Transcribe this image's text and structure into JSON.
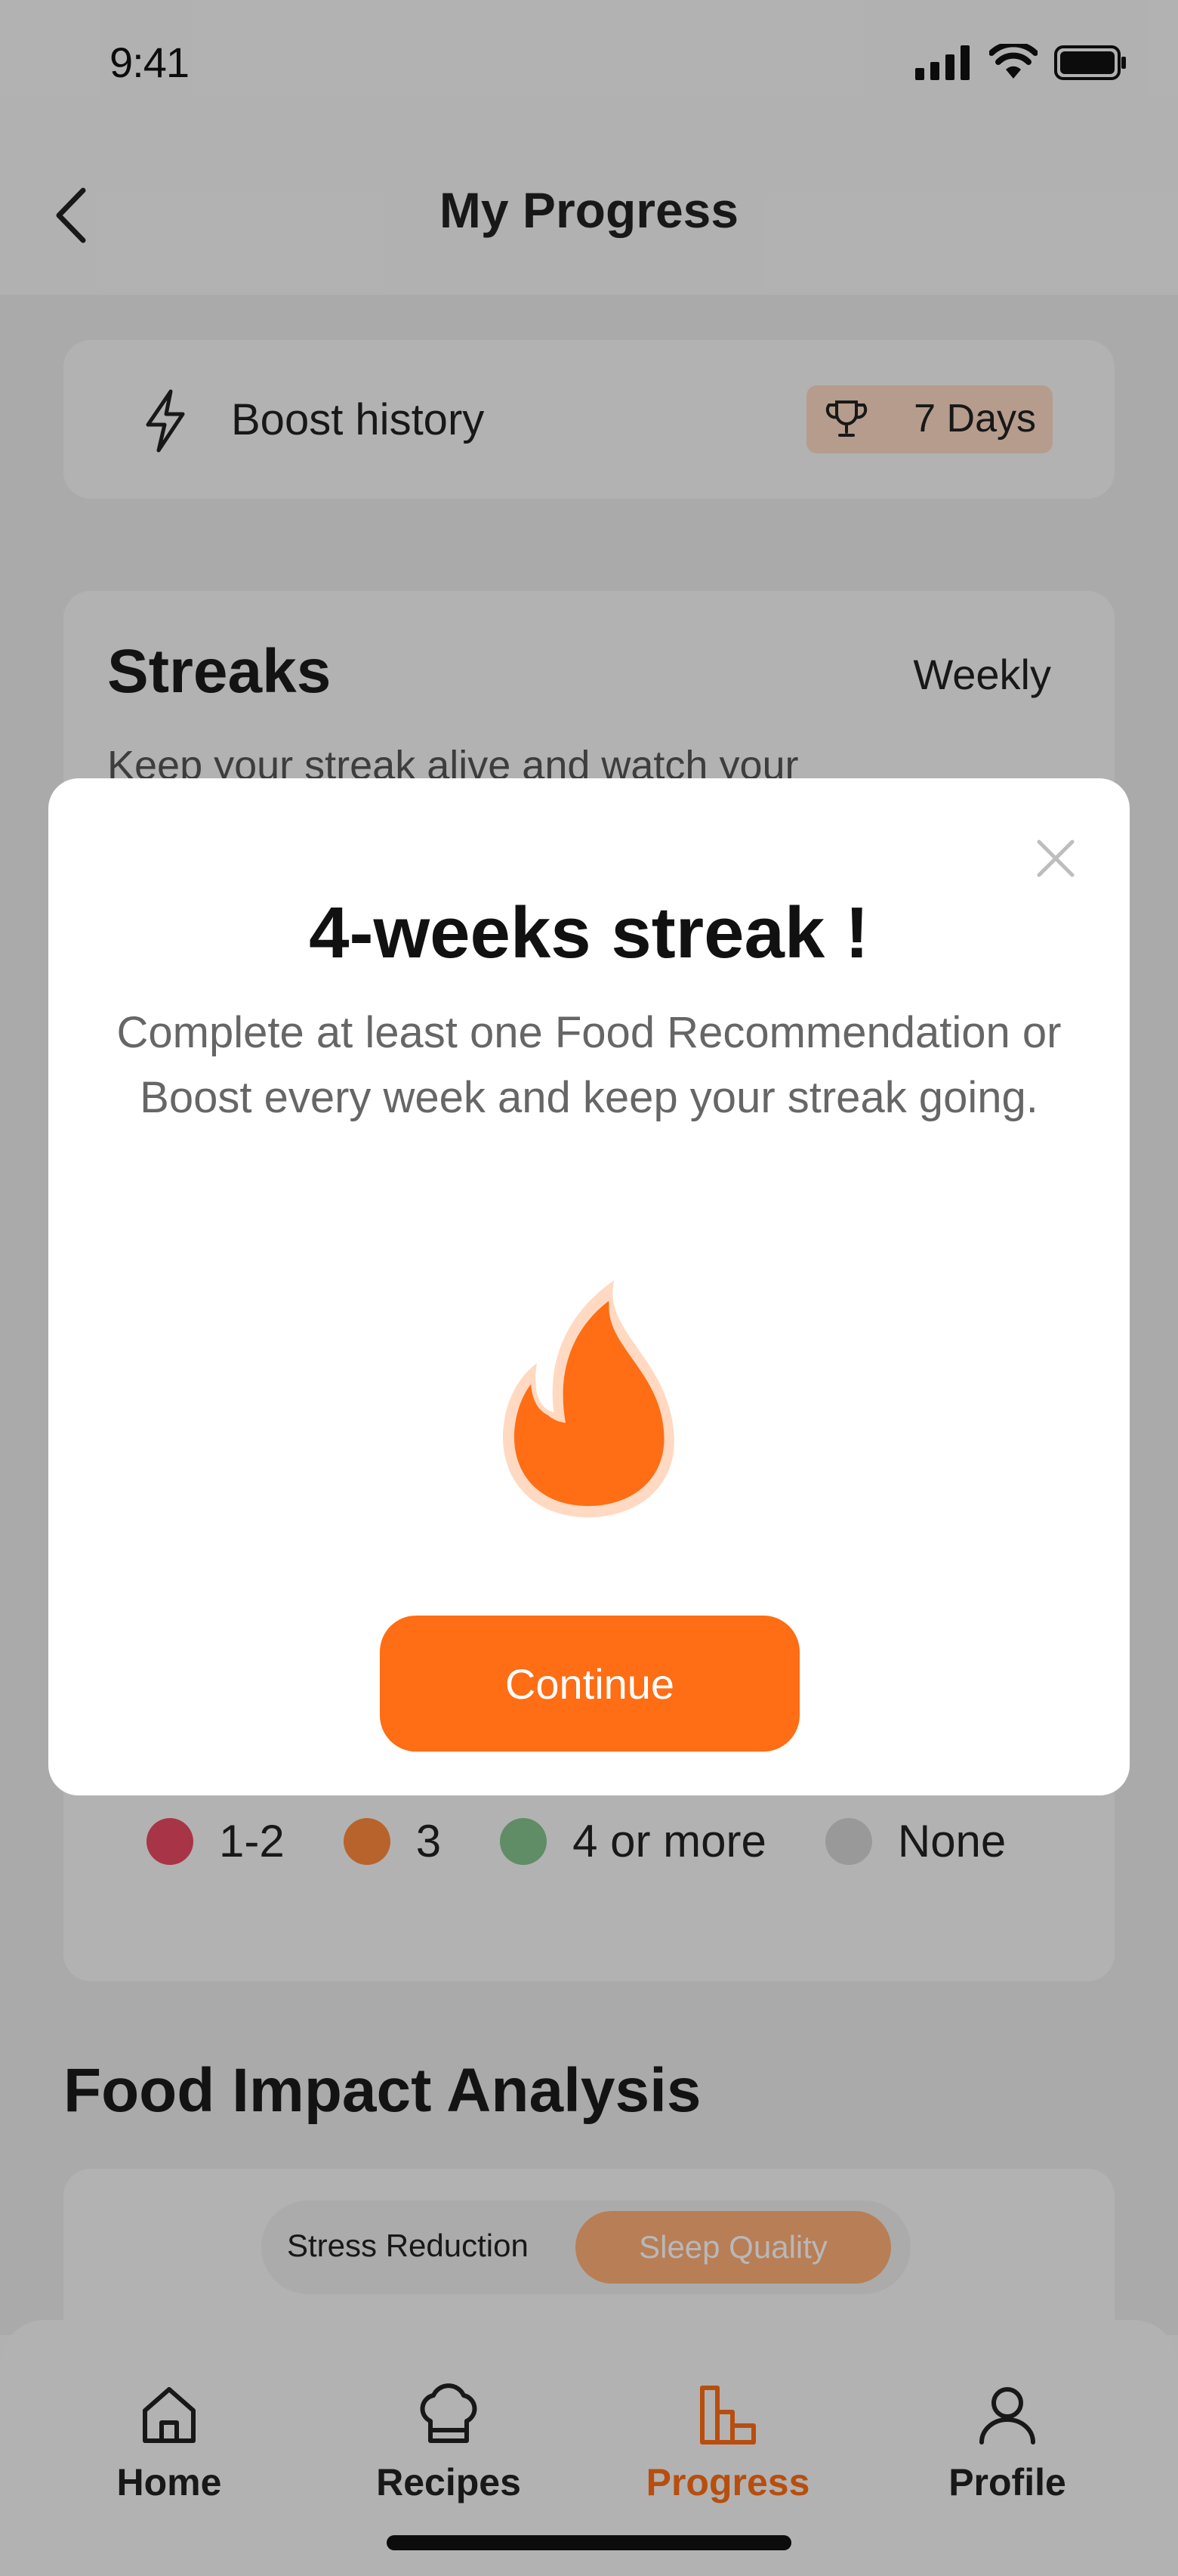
{
  "status_bar": {
    "time": "9:41"
  },
  "header": {
    "title": "My Progress"
  },
  "boost": {
    "label": "Boost history",
    "badge": "7 Days"
  },
  "streaks": {
    "title": "Streaks",
    "period": "Weekly",
    "description": "Keep your streak alive and watch your",
    "legend": [
      {
        "label": "1-2",
        "color": "#e84a63"
      },
      {
        "label": "3",
        "color": "#ff8a3d"
      },
      {
        "label": "4 or more",
        "color": "#86c38e"
      },
      {
        "label": "None",
        "color": "#d4d4d4"
      }
    ],
    "week_bars": [
      "#b9e2bd",
      "#b9e2bd",
      "#d8d8d8",
      "#b9e2bd"
    ]
  },
  "food_impact": {
    "title": "Food Impact Analysis",
    "tabs": [
      "Stress Reduction",
      "Sleep Quality"
    ],
    "active_tab": "Sleep Quality"
  },
  "modal": {
    "title": "4-weeks streak !",
    "body": "Complete at least one Food Recommendation or Boost every week and keep your streak going.",
    "button": "Continue",
    "accent": "#ff6d14"
  },
  "tabbar": {
    "items": [
      {
        "label": "Home",
        "icon": "home-icon",
        "active": false
      },
      {
        "label": "Recipes",
        "icon": "chef-hat-icon",
        "active": false
      },
      {
        "label": "Progress",
        "icon": "bar-chart-icon",
        "active": true
      },
      {
        "label": "Profile",
        "icon": "person-icon",
        "active": false
      }
    ],
    "active_color": "#ff6d14"
  }
}
